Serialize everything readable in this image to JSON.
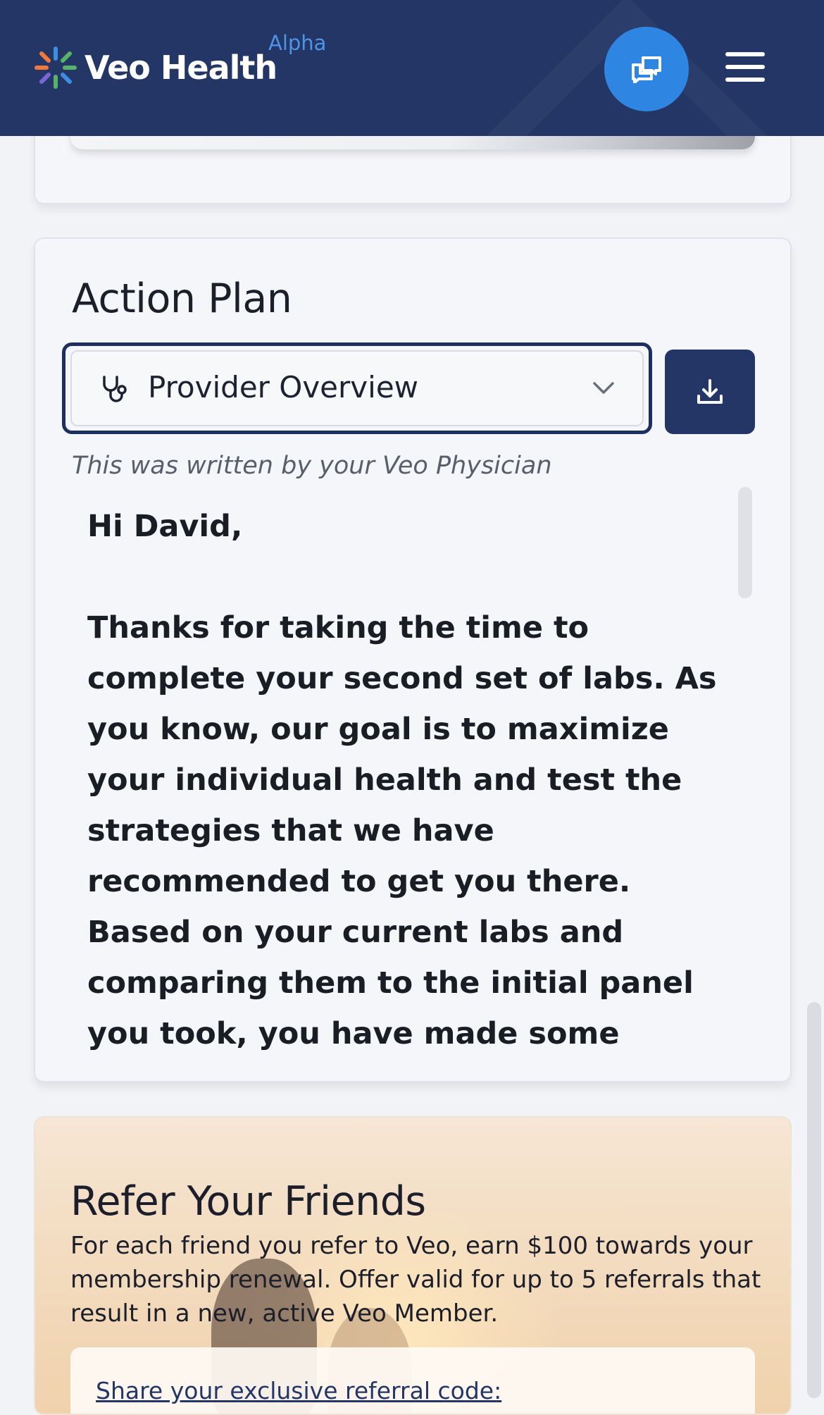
{
  "header": {
    "brand_name": "Veo Health",
    "brand_badge": "Alpha"
  },
  "icons": {
    "logo": "veo-health-logo-mark",
    "chat": "chat-bubbles-icon",
    "menu": "hamburger-menu-icon",
    "provider": "stethoscope-icon",
    "dropdown": "chevron-down-icon",
    "download": "download-icon"
  },
  "colors": {
    "header_bg": "#243665",
    "accent_blue": "#2f86e2",
    "badge_blue": "#4d94e6",
    "logo_orange": "#f07a3a",
    "logo_green": "#57b36a",
    "logo_blue": "#3c8fe0",
    "logo_purple": "#7a66d6"
  },
  "action_plan": {
    "title": "Action Plan",
    "selected_view": "Provider Overview",
    "written_by": "This was written by your Veo Physician",
    "greeting": "Hi David,",
    "body": "Thanks for taking the time to complete your second set of labs. As you know, our goal is to maximize your individual health and test the strategies that we have recommended to get you there. Based on your current labs and comparing them to the initial panel you took, you have made some outstanding strides:"
  },
  "refer": {
    "title": "Refer Your Friends",
    "description": "For each friend you refer to Veo, earn $100 towards your membership renewal. Offer valid for up to 5 referrals that result in a new, active Veo Member.",
    "share_label": "Share your exclusive referral code:"
  }
}
